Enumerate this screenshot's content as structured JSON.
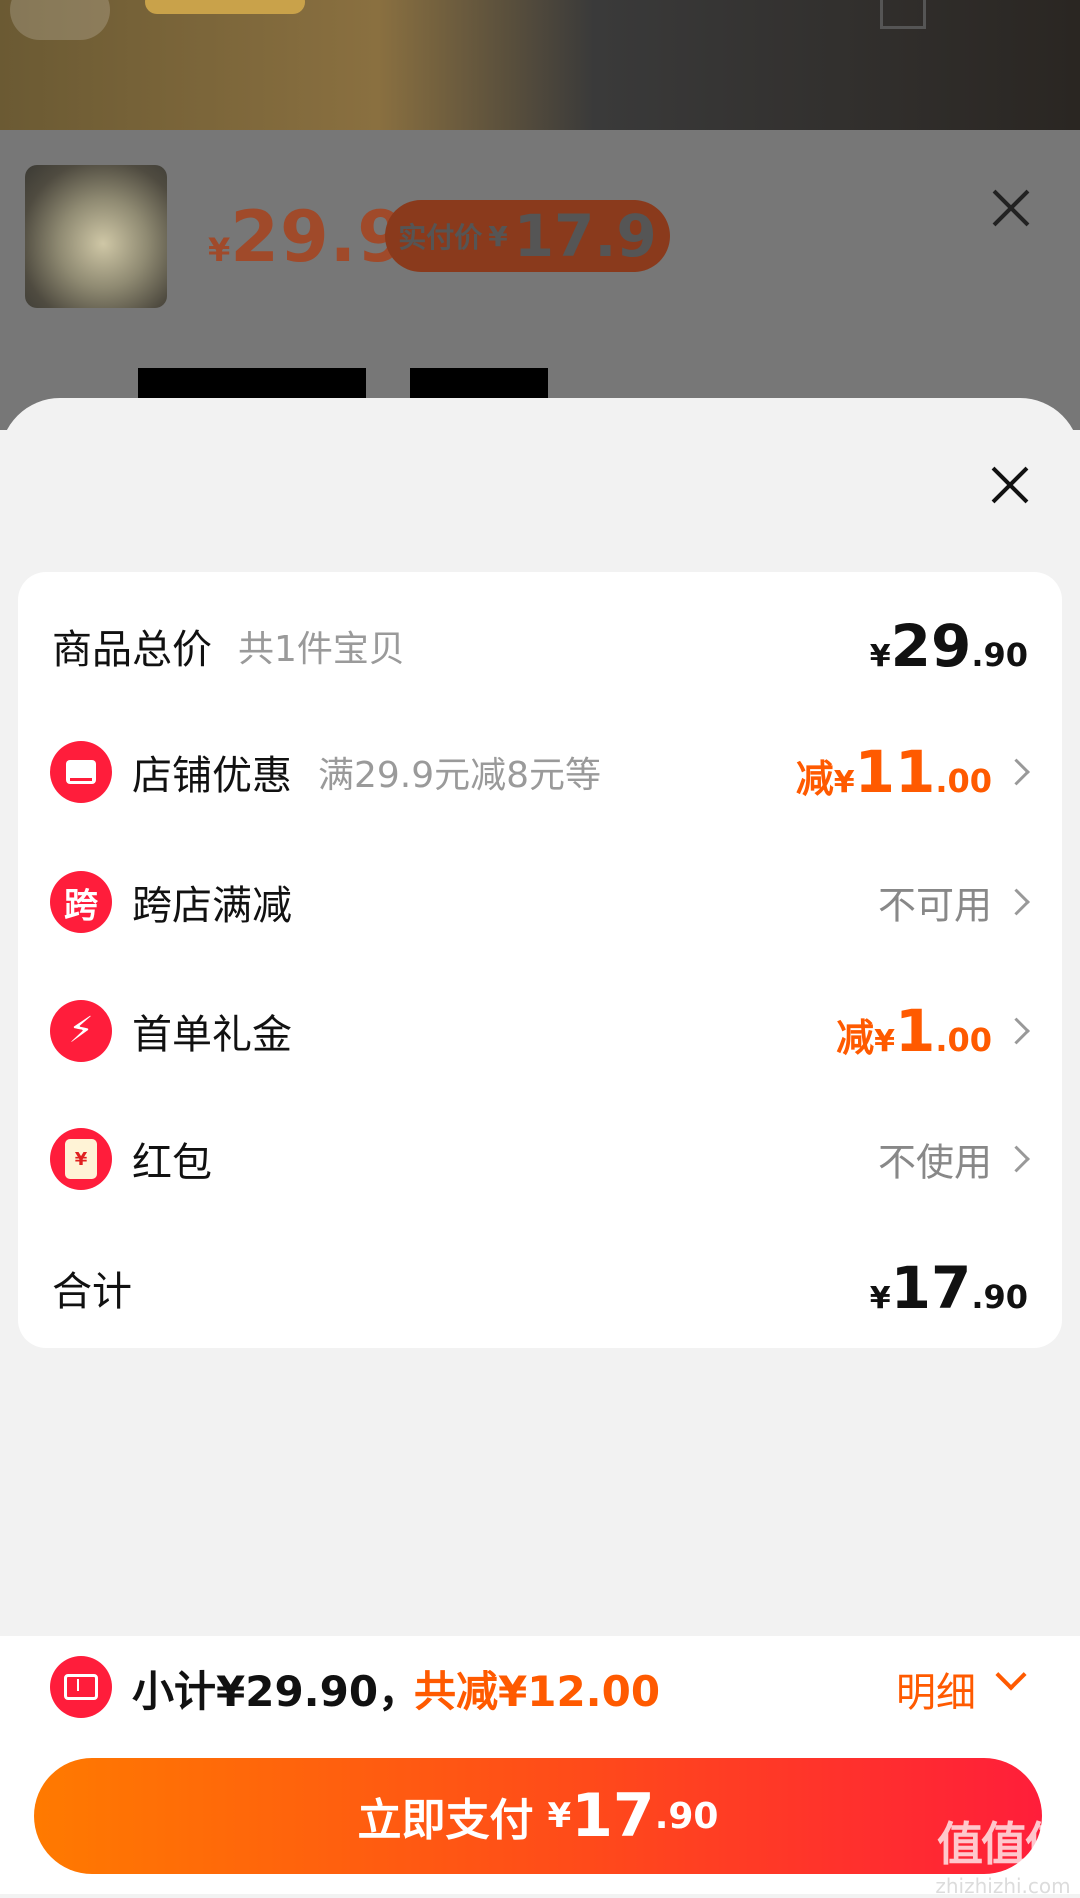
{
  "background": {
    "price_symbol": "¥",
    "price": "29.9",
    "pay_label": "实付价",
    "pay_symbol": "¥",
    "pay_price": "17.9"
  },
  "sheet": {
    "card": {
      "goods_total": {
        "label": "商品总价",
        "sub": "共1件宝贝",
        "symbol": "¥",
        "int": "29",
        "dec": ".90"
      },
      "rows": [
        {
          "label": "店铺优惠",
          "sub": "满29.9元减8元等",
          "prefix": "减",
          "symbol": "¥",
          "int": "11",
          "dec": ".00"
        },
        {
          "label": "跨店满减",
          "icon_text": "跨",
          "status": "不可用"
        },
        {
          "label": "首单礼金",
          "prefix": "减",
          "symbol": "¥",
          "int": "1",
          "dec": ".00"
        },
        {
          "label": "红包",
          "icon_text": "¥",
          "status": "不使用"
        }
      ],
      "total": {
        "label": "合计",
        "symbol": "¥",
        "int": "17",
        "dec": ".90"
      }
    }
  },
  "bottom_bar": {
    "subtotal": "小计¥29.90，",
    "total_discount": "共减¥12.00",
    "detail_label": "明细",
    "pay_button": {
      "label": "立即支付",
      "symbol": "¥",
      "int": "17",
      "dec": ".90"
    }
  },
  "watermark": {
    "logo": "值值值",
    "url": "zhizhizhi.com"
  },
  "colors": {
    "accent": "#ff5a00",
    "icon_red": "#ff1d3b",
    "button_start": "#ff7a00",
    "button_end": "#ff1e3a"
  },
  "icons": [
    "close-icon",
    "shop-icon",
    "cross-store-icon",
    "bolt-icon",
    "red-packet-icon",
    "chevron-right-icon",
    "chevron-down-icon",
    "ticket-icon"
  ]
}
